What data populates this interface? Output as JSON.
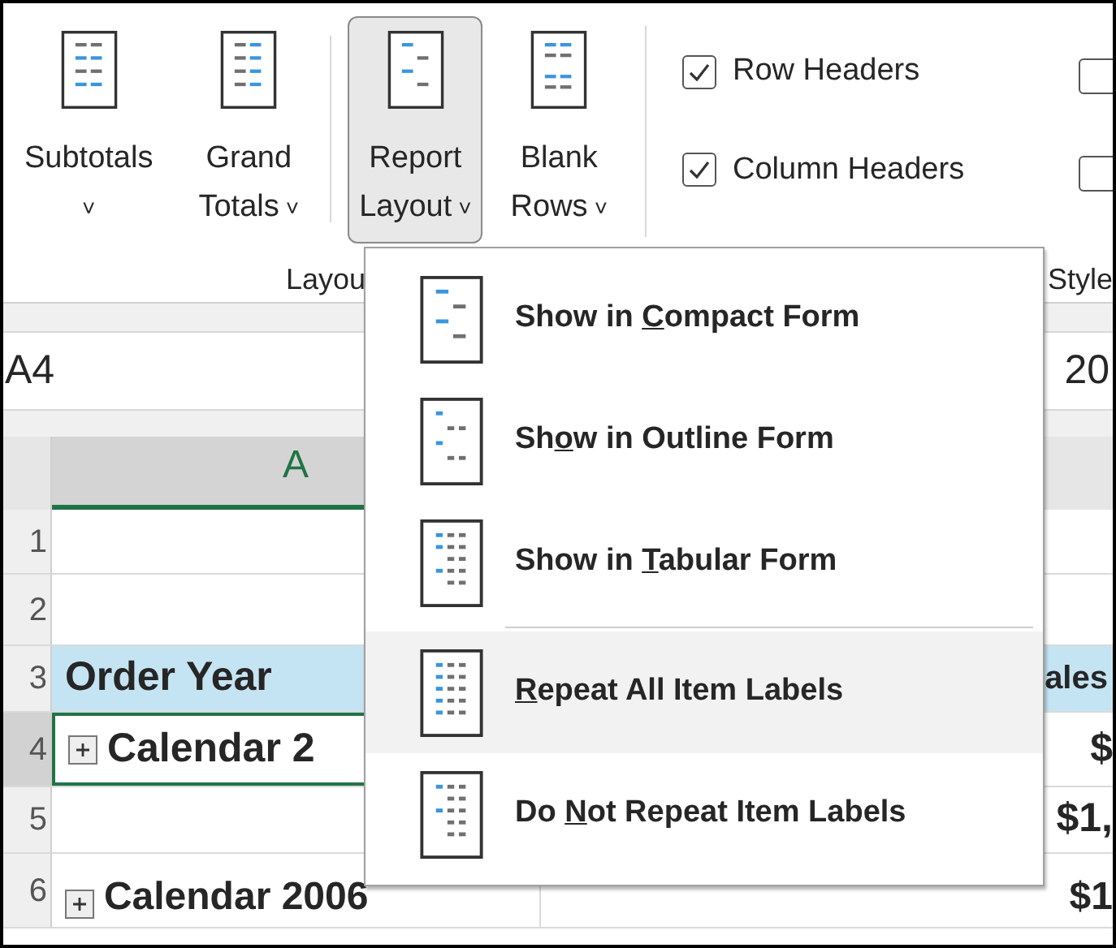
{
  "ribbon": {
    "buttons": [
      {
        "label_lines": [
          "Subtotals"
        ],
        "caret": "˅",
        "pressed": false
      },
      {
        "label_lines": [
          "Grand",
          "Totals"
        ],
        "caret": "˅",
        "pressed": false
      },
      {
        "label_lines": [
          "Report",
          "Layout"
        ],
        "caret": "˅",
        "pressed": true
      },
      {
        "label_lines": [
          "Blank",
          "Rows"
        ],
        "caret": "˅",
        "pressed": false
      }
    ],
    "group_label": "Layou",
    "options": [
      {
        "label": "Row Headers",
        "checked": true
      },
      {
        "label": "Column Headers",
        "checked": true
      }
    ],
    "cut_options": [
      {
        "checked": false
      },
      {
        "checked": false
      }
    ],
    "next_group_label": "Style"
  },
  "formula_bar": {
    "name_box": "A4",
    "formula": "20"
  },
  "sheet": {
    "column_header": "A",
    "rows": [
      {
        "number": "1",
        "cells": [
          "",
          "",
          ""
        ]
      },
      {
        "number": "2",
        "cells": [
          "",
          "",
          ""
        ]
      },
      {
        "number": "3",
        "kind": "header",
        "cells": [
          "Order Year",
          "",
          "ales"
        ]
      },
      {
        "number": "4",
        "active": true,
        "expand": true,
        "cells": [
          "Calendar 2",
          "",
          "$"
        ]
      },
      {
        "number": "5",
        "cells": [
          "",
          "",
          "$1,"
        ]
      },
      {
        "number": "6",
        "expand": true,
        "cells": [
          "Calendar 2006",
          "",
          "$1"
        ]
      }
    ]
  },
  "menu": {
    "items": [
      {
        "before": "Show in ",
        "key": "C",
        "after": "ompact Form",
        "hovered": false
      },
      {
        "before": "Sh",
        "key": "o",
        "after": "w in Outline Form",
        "hovered": false
      },
      {
        "before": "Show in ",
        "key": "T",
        "after": "abular Form",
        "hovered": false,
        "separator_after": true
      },
      {
        "key": "R",
        "after": "epeat All Item Labels",
        "hovered": true
      },
      {
        "before": "Do ",
        "key": "N",
        "after": "ot Repeat Item Labels",
        "hovered": false
      }
    ]
  }
}
